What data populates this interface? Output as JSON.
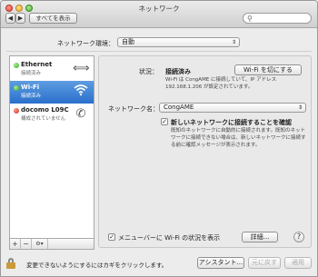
{
  "window": {
    "title": "ネットワーク",
    "back_label": "◀",
    "forward_label": "▶",
    "show_all_label": "すべてを表示",
    "search_placeholder": ""
  },
  "location": {
    "label": "ネットワーク環境：",
    "value": "自動"
  },
  "services": [
    {
      "name": "Ethernet",
      "status": "接続済み",
      "status_color": "green",
      "icon": "ethernet-arrows-icon"
    },
    {
      "name": "Wi-Fi",
      "status": "接続済み",
      "status_color": "green",
      "icon": "wifi-icon",
      "selected": true
    },
    {
      "name": "docomo L09C",
      "status": "構成されていません",
      "status_color": "red",
      "icon": "phone-icon"
    }
  ],
  "sidebar_tools": {
    "add": "+",
    "remove": "−",
    "action": "⚙▾"
  },
  "detail": {
    "status_label": "状況：",
    "status_value": "接続済み",
    "wifi_off_button": "Wi-Fi を切にする",
    "status_desc_line1": "Wi-Fi は CongAME に接続していて、IP アドレス",
    "status_desc_line2": "192.168.1.206 が設定されています。",
    "network_name_label": "ネットワーク名：",
    "network_name_value": "CongAME",
    "ask_to_join_label": "新しいネットワークに接続することを確認",
    "ask_to_join_checked": "✓",
    "ask_desc_line1": "既知のネットワークに自動的に接続されます。既知のネット",
    "ask_desc_line2": "ワークに接続できない場合は、新しいネットワークに接続す",
    "ask_desc_line3": "る前に確認メッセージが表示されます。",
    "menubar_label": "メニューバーに Wi-Fi の状況を表示",
    "menubar_checked": "✓",
    "advanced_button": "詳細...",
    "help_button": "?"
  },
  "footer": {
    "lock_text": "変更できないようにするにはカギをクリックします。",
    "assistant_button": "アシスタント...",
    "revert_button": "元に戻す",
    "apply_button": "適用"
  }
}
